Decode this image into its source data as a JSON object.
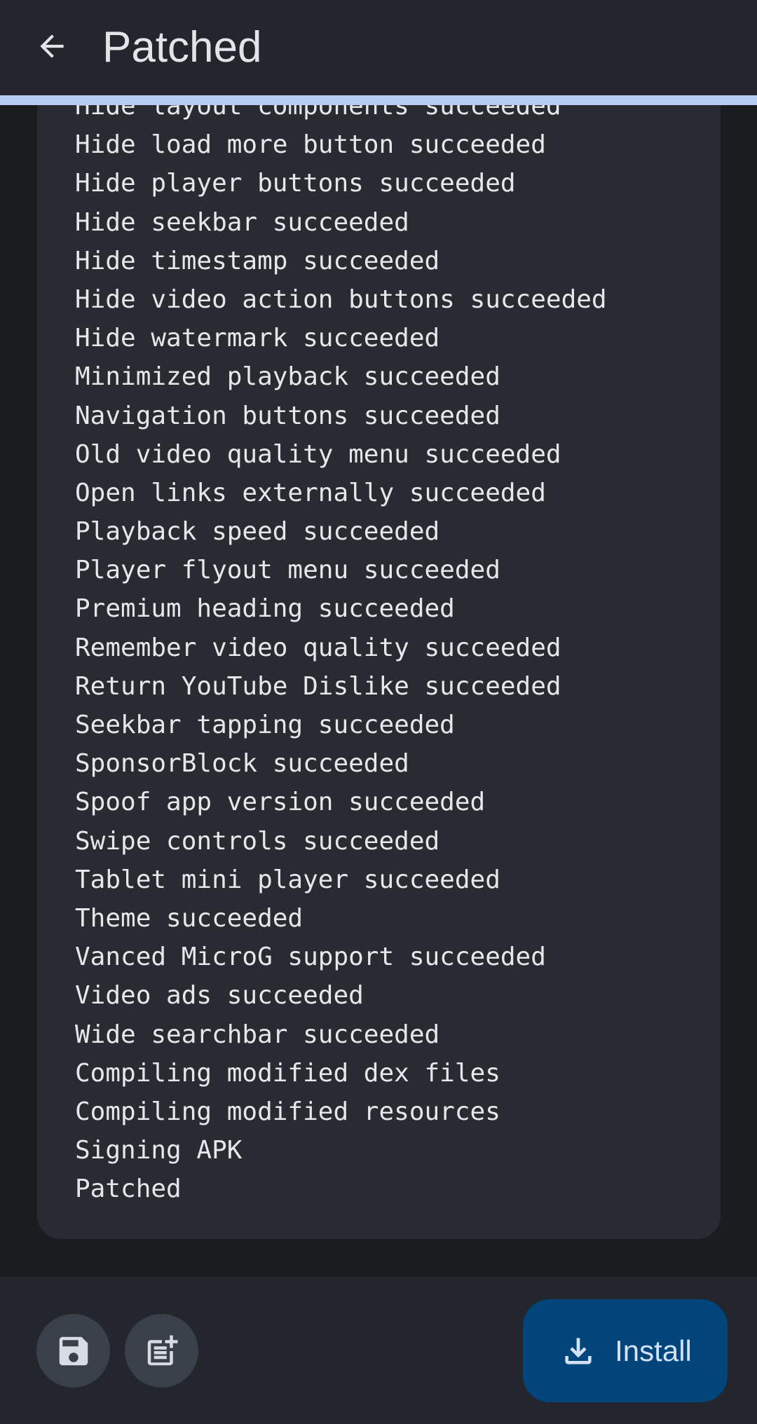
{
  "header": {
    "title": "Patched",
    "back_icon": "arrow-back-icon"
  },
  "progress": {
    "value": 1.0,
    "color": "#b6cdf3"
  },
  "log": {
    "lines": [
      "Hide layout components succeeded",
      "Hide load more button succeeded",
      "Hide player buttons succeeded",
      "Hide seekbar succeeded",
      "Hide timestamp succeeded",
      "Hide video action buttons succeeded",
      "Hide watermark succeeded",
      "Minimized playback succeeded",
      "Navigation buttons succeeded",
      "Old video quality menu succeeded",
      "Open links externally succeeded",
      "Playback speed succeeded",
      "Player flyout menu succeeded",
      "Premium heading succeeded",
      "Remember video quality succeeded",
      "Return YouTube Dislike succeeded",
      "Seekbar tapping succeeded",
      "SponsorBlock succeeded",
      "Spoof app version succeeded",
      "Swipe controls succeeded",
      "Tablet mini player succeeded",
      "Theme succeeded",
      "Vanced MicroG support succeeded",
      "Video ads succeeded",
      "Wide searchbar succeeded",
      "Compiling modified dex files",
      "Compiling modified resources",
      "Signing APK",
      "Patched"
    ]
  },
  "actions": {
    "save_icon": "save-icon",
    "export_log_icon": "post-add-icon",
    "install_icon": "download-icon",
    "install_label": "Install"
  },
  "colors": {
    "background": "#1b1c1f",
    "surface": "#23262d",
    "card": "#282b31",
    "text": "#e6e7ea",
    "icon_button": "#3a4049",
    "primary_container": "#01457b",
    "on_primary_container": "#d3e2f6"
  }
}
